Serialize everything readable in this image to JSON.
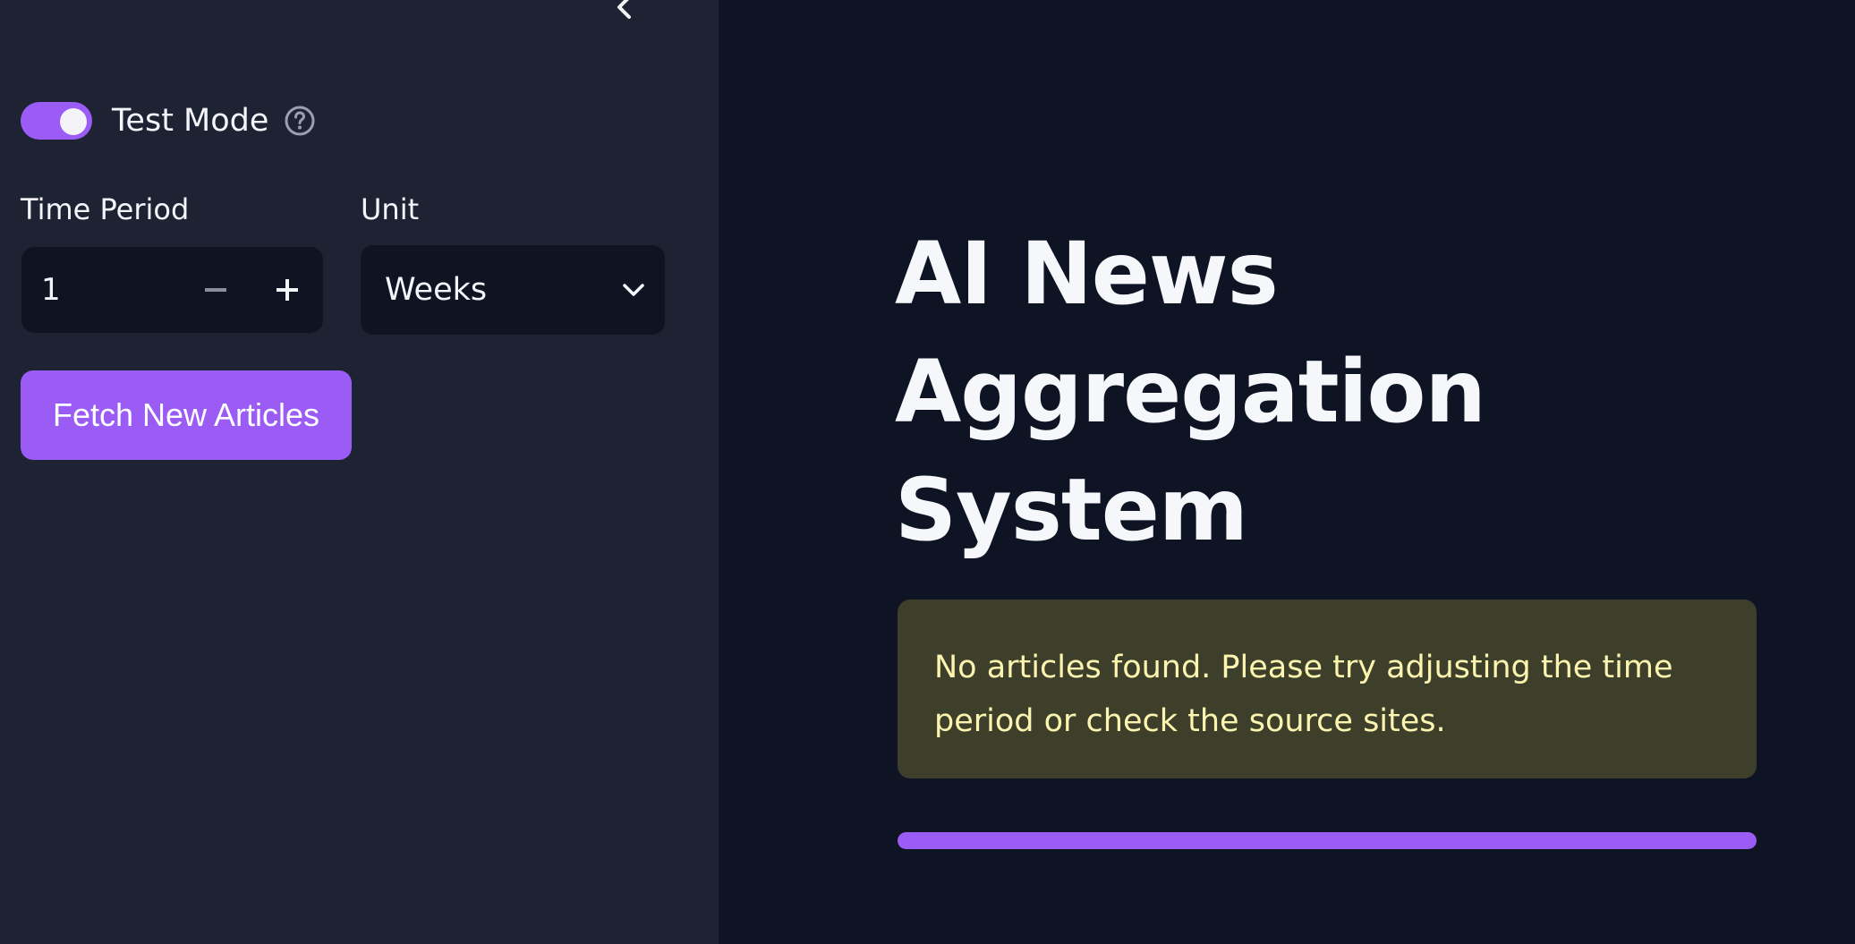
{
  "sidebar": {
    "collapse_icon": "chevron-left-icon",
    "test_mode": {
      "label": "Test Mode",
      "enabled": true,
      "help_icon": "question-circle-icon"
    },
    "time_period": {
      "label": "Time Period",
      "value": "1",
      "decrement_icon": "minus-icon",
      "increment_icon": "plus-icon"
    },
    "unit": {
      "label": "Unit",
      "value": "Weeks",
      "dropdown_icon": "chevron-down-icon"
    },
    "fetch_button": {
      "label": "Fetch New Articles"
    }
  },
  "main": {
    "title": "AI News Aggregation System",
    "warning": "No articles found. Please try adjusting the time period or check the source sites.",
    "progress": 1.0
  },
  "colors": {
    "accent": "#9b5cf6",
    "sidebar_bg": "#1e2333",
    "main_bg": "#0e1424",
    "input_bg": "#0f1422",
    "warning_bg": "#3e3f2b",
    "warning_text": "#fbf5b0"
  }
}
